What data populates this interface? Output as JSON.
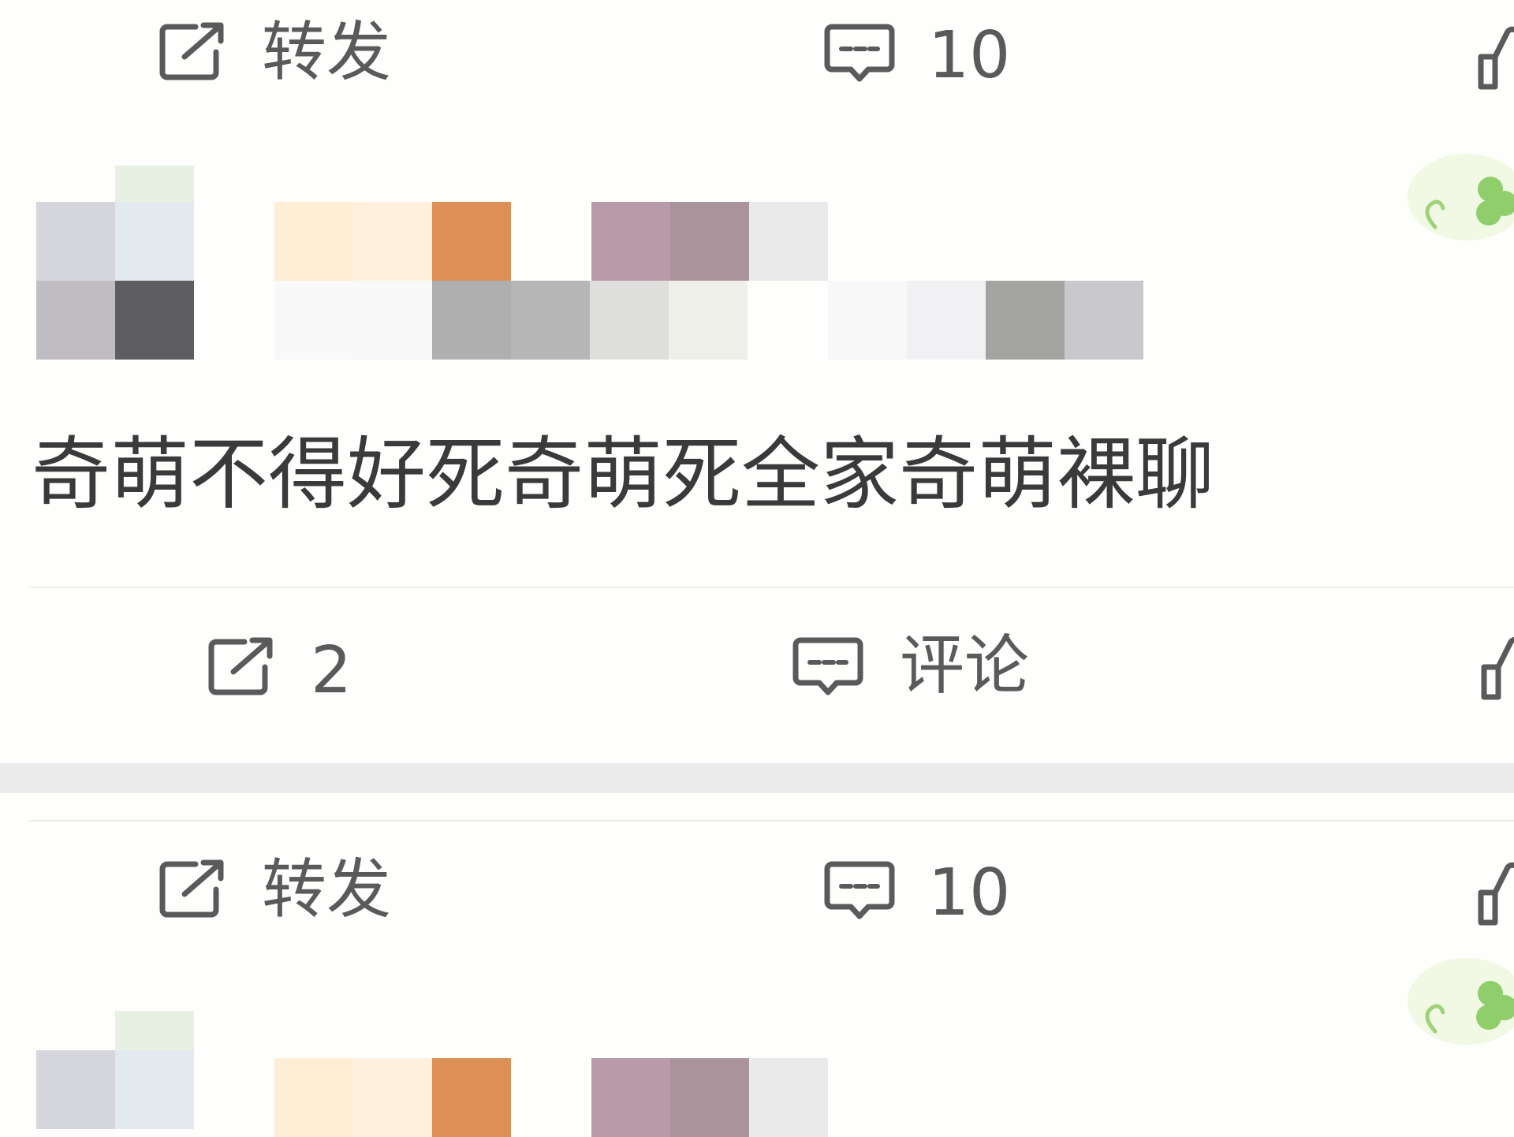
{
  "feed": {
    "top_action_bar": {
      "repost_label": "转发",
      "comment_count": "10"
    },
    "post": {
      "text": "奇萌不得好死奇萌死全家奇萌裸聊",
      "action_bar": {
        "repost_count": "2",
        "comment_label": "评论"
      }
    },
    "next_action_bar": {
      "repost_label": "转发",
      "comment_count": "10"
    }
  },
  "colors": {
    "icon": "#5a5a5a",
    "divider": "#ececec",
    "background": "#fefefc",
    "clover": "#8fce6a"
  },
  "icons": [
    "share-icon",
    "comment-icon",
    "like-icon",
    "clover-decoration-icon"
  ]
}
